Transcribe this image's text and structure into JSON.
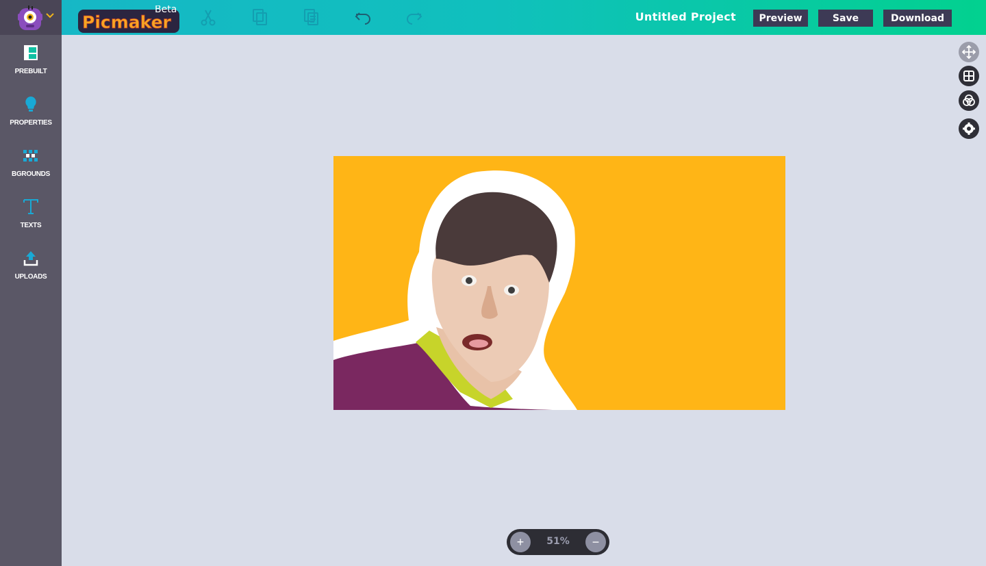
{
  "header": {
    "logo_text": "Picmaker",
    "logo_badge": "Beta",
    "project_title": "Untitled Project",
    "buttons": {
      "preview": "Preview",
      "save": "Save",
      "download": "Download"
    },
    "tools": [
      "cut-icon",
      "copy-icon",
      "paste-icon",
      "undo-icon",
      "redo-icon"
    ]
  },
  "sidebar": {
    "items": [
      {
        "label": "PREBUILT",
        "icon": "layout-icon"
      },
      {
        "label": "PROPERTIES",
        "icon": "bulb-icon"
      },
      {
        "label": "BGROUNDS",
        "icon": "pattern-icon"
      },
      {
        "label": "TEXTS",
        "icon": "text-icon"
      },
      {
        "label": "UPLOADS",
        "icon": "upload-icon"
      }
    ]
  },
  "canvas": {
    "background_color": "#ffb516"
  },
  "right_tools": [
    "move-icon",
    "grid-icon",
    "color-blend-icon",
    "settings-icon"
  ],
  "zoom": {
    "value": "51%",
    "plus": "+",
    "minus": "−"
  },
  "colors": {
    "accent_teal": "#17b6c7",
    "accent_green": "#02d18f",
    "button_bg": "#3d3a55",
    "sidebar_bg": "#5a5766",
    "workspace_bg": "#d9dde9",
    "icon_blue": "#19a9d5"
  }
}
